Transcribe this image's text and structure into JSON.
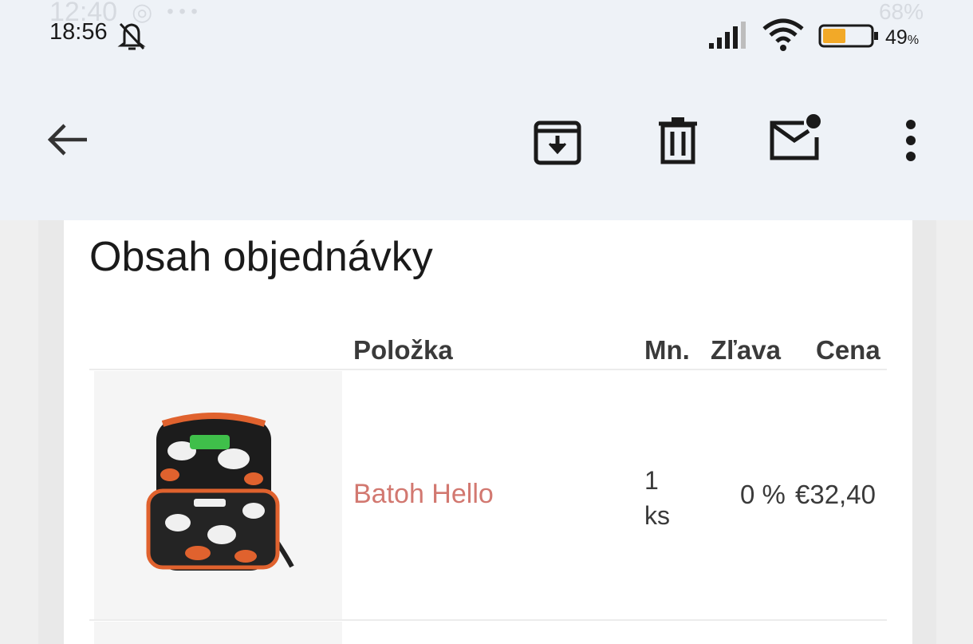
{
  "status_bar": {
    "time": "18:56",
    "battery_percent": "49",
    "battery_unit": "%",
    "ghost_time": "12:40",
    "ghost_battery": "68%",
    "icons": [
      "bell-off-icon",
      "signal-icon",
      "wifi-icon",
      "battery-icon"
    ]
  },
  "app_bar": {
    "icons": [
      "back-arrow-icon",
      "archive-icon",
      "delete-icon",
      "mark-unread-icon",
      "more-vert-icon"
    ]
  },
  "email": {
    "section_title": "Obsah objednávky",
    "table": {
      "headers": [
        "Položka",
        "Mn.",
        "Zľava",
        "Cena"
      ],
      "rows": [
        {
          "image": "backpack-product-image",
          "item": "Batoh Hello",
          "qty_value": "1",
          "qty_unit": "ks",
          "discount": "0 %",
          "price": "€32,40"
        }
      ]
    }
  },
  "colors": {
    "background": "#eef2f7",
    "link": "#d27870",
    "card": "#ffffff"
  }
}
